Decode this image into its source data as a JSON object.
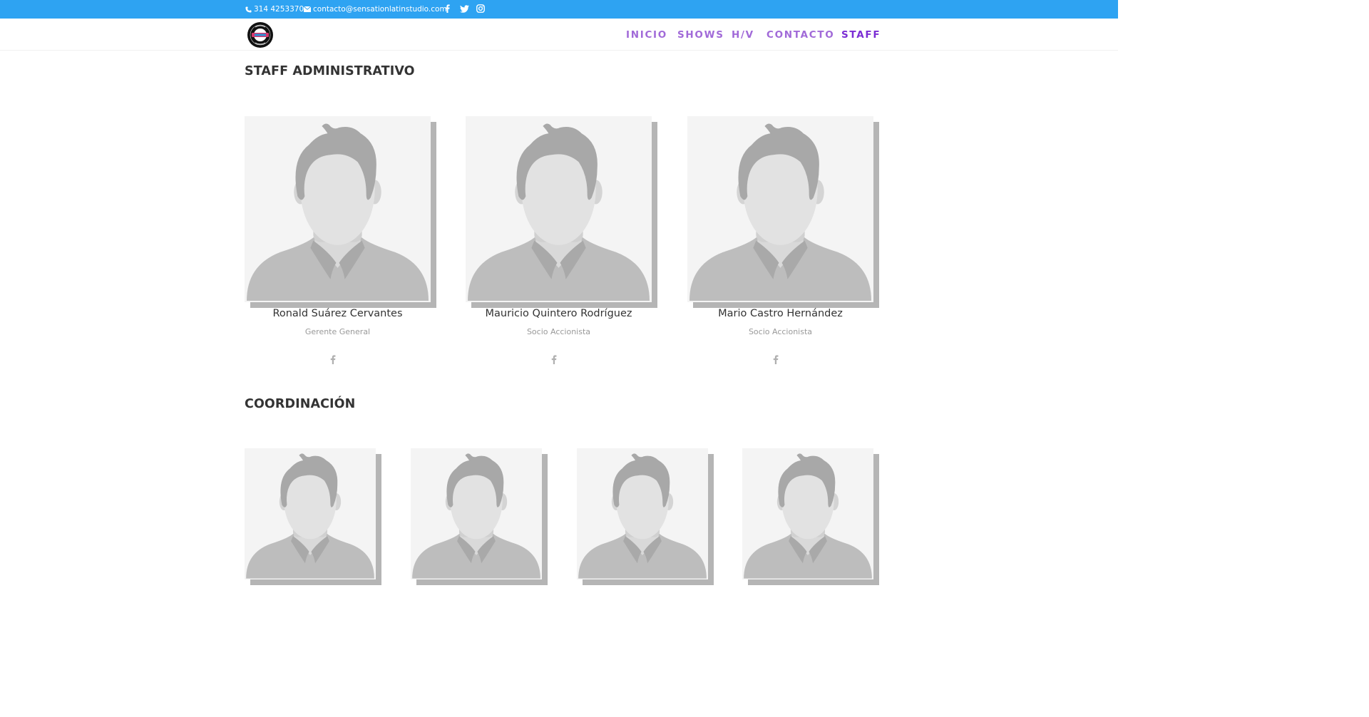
{
  "topbar": {
    "phone": "314 4253370",
    "email": "contacto@sensationlatinstudio.com",
    "social": [
      "facebook-icon",
      "twitter-icon",
      "instagram-icon"
    ],
    "bg_color": "#2ea3f2"
  },
  "header": {
    "nav": [
      {
        "label": "INICIO",
        "active": false
      },
      {
        "label": "SHOWS",
        "active": false
      },
      {
        "label": "H/V",
        "active": false
      },
      {
        "label": "CONTACTO",
        "active": false
      },
      {
        "label": "STAFF",
        "active": true
      }
    ],
    "nav_color": "#a16ad8",
    "active_color": "#7b2dd4"
  },
  "sections": [
    {
      "title": "STAFF ADMINISTRATIVO",
      "members": [
        {
          "name": "Ronald Suárez Cervantes",
          "role": "Gerente General",
          "social": "facebook-icon"
        },
        {
          "name": "Mauricio Quintero Rodríguez",
          "role": "Socio Accionista",
          "social": "facebook-icon"
        },
        {
          "name": "Mario Castro Hernández",
          "role": "Socio Accionista",
          "social": "facebook-icon"
        }
      ]
    },
    {
      "title": "COORDINACIÓN",
      "members": [
        {
          "photo": "person-placeholder"
        },
        {
          "photo": "person-placeholder"
        },
        {
          "photo": "person-placeholder"
        },
        {
          "photo": "person-placeholder"
        }
      ]
    }
  ]
}
